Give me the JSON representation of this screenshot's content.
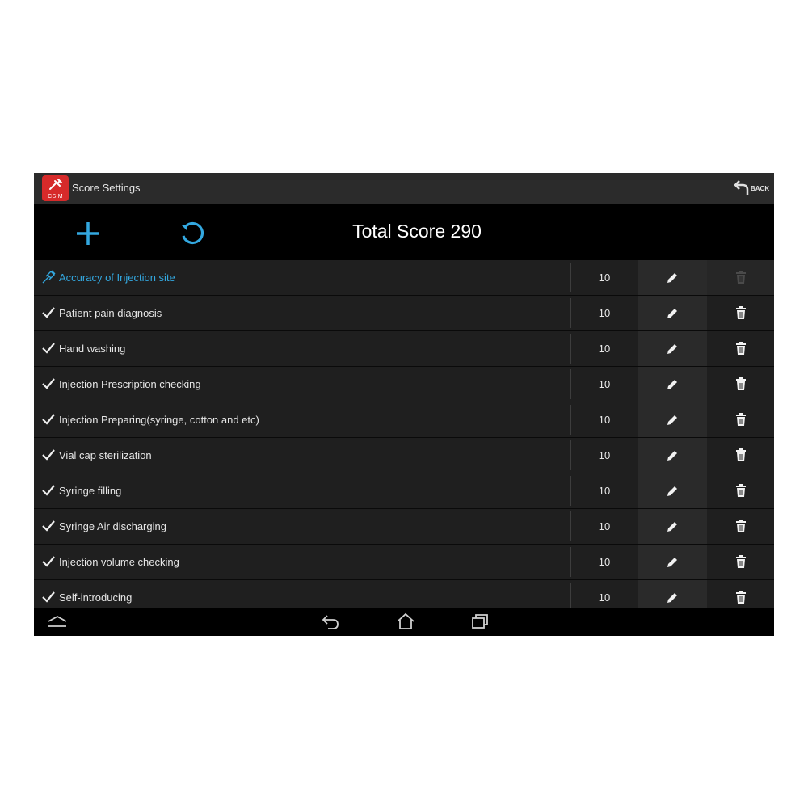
{
  "action_bar": {
    "app_icon_label": "CSIM",
    "title": "Score Settings",
    "back_label": "BACK"
  },
  "toolbar": {
    "add_icon": "plus-icon",
    "refresh_icon": "refresh-icon",
    "total_score": "Total Score 290"
  },
  "rows": [
    {
      "label": "Accuracy of Injection site",
      "score": "10",
      "selected": true
    },
    {
      "label": "Patient pain diagnosis",
      "score": "10",
      "selected": false
    },
    {
      "label": "Hand washing",
      "score": "10",
      "selected": false
    },
    {
      "label": "Injection Prescription checking",
      "score": "10",
      "selected": false
    },
    {
      "label": "Injection Preparing(syringe, cotton and etc)",
      "score": "10",
      "selected": false
    },
    {
      "label": "Vial cap sterilization",
      "score": "10",
      "selected": false
    },
    {
      "label": "Syringe filling",
      "score": "10",
      "selected": false
    },
    {
      "label": "Syringe Air discharging",
      "score": "10",
      "selected": false
    },
    {
      "label": "Injection volume checking",
      "score": "10",
      "selected": false
    },
    {
      "label": "Self-introducing",
      "score": "10",
      "selected": false
    }
  ],
  "colors": {
    "accent": "#33a8e0",
    "app_icon": "#d62a2a",
    "row_bg": "#1f1f1f",
    "toolbar_bg": "#000000"
  }
}
